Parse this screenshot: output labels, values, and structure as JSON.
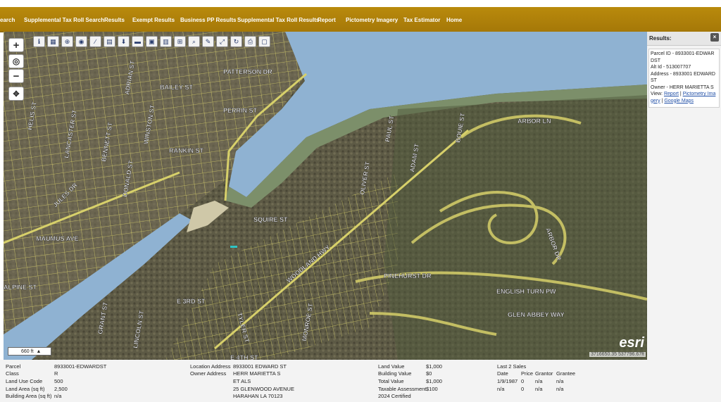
{
  "nav": {
    "items": [
      "earch",
      "Supplemental Tax Roll Search",
      "Results",
      "Exempt Results",
      "Business PP Results",
      "Supplemental Tax Roll Results",
      "Report",
      "Pictometry Imagery",
      "Tax Estimator",
      "Home"
    ]
  },
  "map": {
    "zoom_in": "+",
    "zoom_out": "−",
    "scale_label": "660 ft",
    "coords": "3716650.35 537796.67ft",
    "logo": "esri",
    "street_labels": [
      "PATTERSON DR",
      "BAILEY ST",
      "PERRIN ST",
      "RANKIN ST",
      "SQUIRE ST",
      "WOODLAND HWY",
      "ARBOR LN",
      "ARBOR DR",
      "ENGLISH TURN PW",
      "GLEN ABBEY WAY",
      "PINEHURST DR",
      "MAUMUS AVE",
      "JULES DR",
      "TYLER ST",
      "E 3RD ST",
      "GRANT ST",
      "LINCOLN ST",
      "OLIVER ST",
      "ADAM ST",
      "MONROE ST",
      "E 4TH ST",
      "ALPINE ST",
      "WINSTON ST",
      "DONALD ST",
      "BENNETT ST",
      "LANCASTER ST",
      "HELIS ST",
      "ADRIAN ST",
      "PAUL ST",
      "BOUIE ST"
    ]
  },
  "results": {
    "title": "Results:",
    "close": "×",
    "parcel_id": "Parcel ID - 8933001-EDWARDST",
    "alt_id": "Alt Id - 513007707",
    "address": "Address - 8933001 EDWARD ST",
    "owner": "Owner - HERR MARIETTA S",
    "view_label": "View:",
    "link_report": "Report",
    "link_pictometry": "Pictometry Imagery",
    "link_google": "Google Maps"
  },
  "info": {
    "col1": {
      "labels": [
        "Parcel",
        "Class",
        "Land Use Code",
        "Land Area (sq ft)",
        "Building Area (sq ft)"
      ],
      "values": [
        "8933001-EDWARDST",
        "R",
        "500",
        "2,500",
        "n/a"
      ]
    },
    "col2": {
      "location_label": "Location Address",
      "location_value": "8933001 EDWARD ST",
      "owner_label": "Owner Address",
      "owner_lines": [
        "HERR MARIETTA S",
        "ET ALS",
        "25 GLENWOOD AVENUE",
        "HARAHAN LA 70123"
      ]
    },
    "col3": {
      "labels": [
        "Land Value",
        "Building Value",
        "Total Value",
        "Taxable Assessment"
      ],
      "values": [
        "$1,000",
        "$0",
        "$1,000",
        "$100"
      ],
      "certified": "2024 Certified"
    },
    "sales": {
      "title": "Last 2 Sales",
      "headers": [
        "Date",
        "Price",
        "Grantor",
        "Grantee"
      ],
      "rows": [
        [
          "1/9/1987",
          "0",
          "n/a",
          "n/a"
        ],
        [
          "n/a",
          "0",
          "n/a",
          "n/a"
        ]
      ]
    }
  },
  "colors": {
    "nav_bg": "#a57808",
    "parcel_line": "#d7d06a",
    "water": "#8fb2d2"
  }
}
